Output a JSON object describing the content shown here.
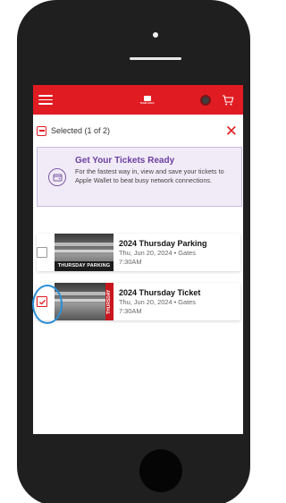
{
  "header": {
    "logo_text": "TEAM LOGO",
    "menu_icon": "hamburger-icon",
    "cart_icon": "cart-icon"
  },
  "selection": {
    "label": "Selected (1 of 2)"
  },
  "promo": {
    "title": "Get Your Tickets Ready",
    "body": "For the fastest way in, view and save your tickets to Apple Wallet to beat busy network connections."
  },
  "tickets": [
    {
      "title": "2024 Thursday Parking",
      "meta": "Thu, Jun 20, 2024 • Gates 7:30AM",
      "banner": "THURSDAY PARKING",
      "checked": false
    },
    {
      "title": "2024 Thursday Ticket",
      "meta": "Thu, Jun 20, 2024 • Gates 7:30AM",
      "banner": "THURSDAY",
      "checked": true
    }
  ],
  "colors": {
    "brand_red": "#e01b22",
    "promo_purple": "#6a3fa0",
    "highlight_blue": "#2b8fd6"
  }
}
